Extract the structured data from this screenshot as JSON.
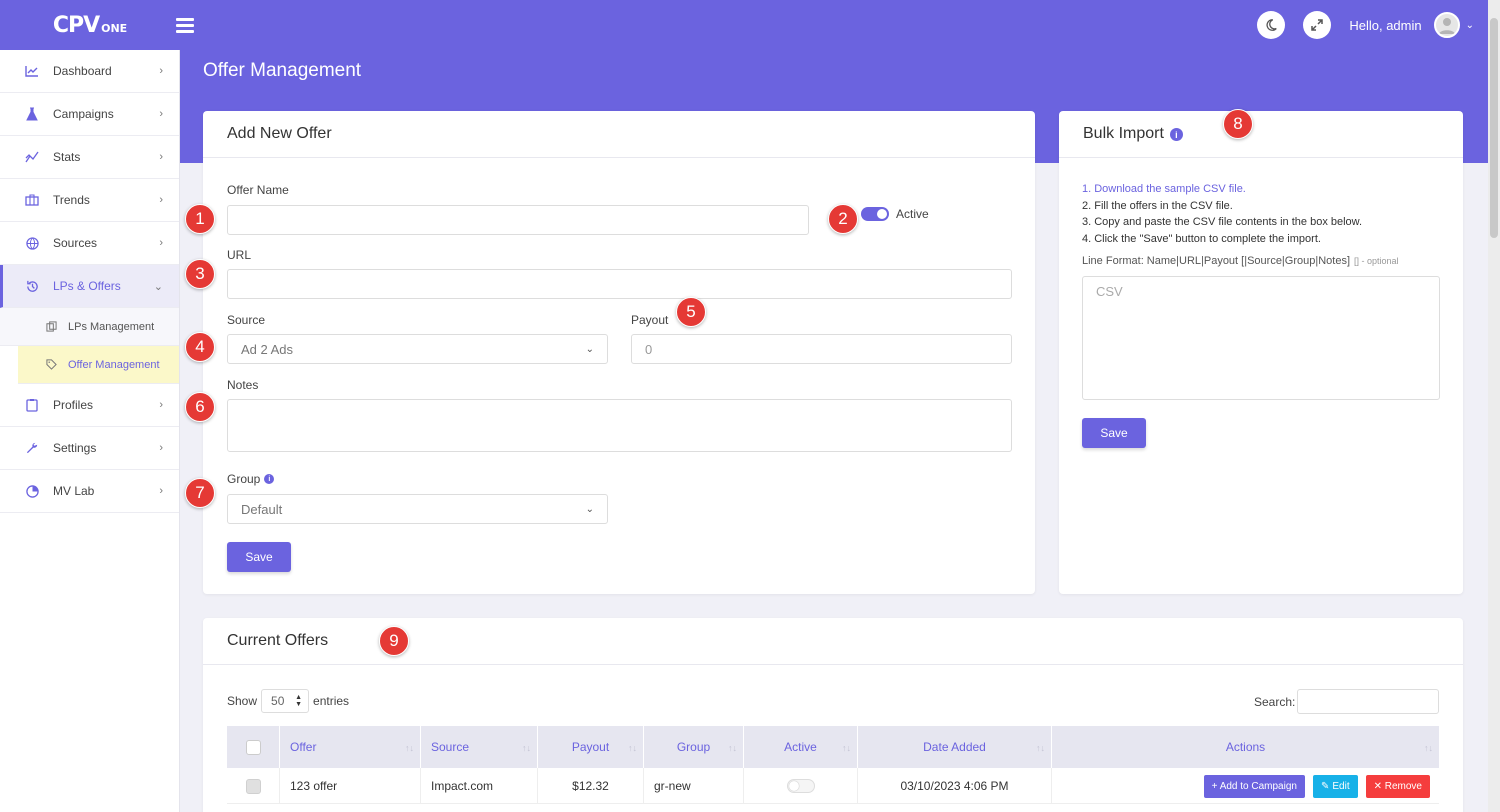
{
  "brand": {
    "logo_main": "CPV",
    "logo_sub": "ONE"
  },
  "topbar": {
    "greeting": "Hello, admin"
  },
  "sidebar": {
    "items": [
      {
        "label": "Dashboard"
      },
      {
        "label": "Campaigns"
      },
      {
        "label": "Stats"
      },
      {
        "label": "Trends"
      },
      {
        "label": "Sources"
      },
      {
        "label": "LPs & Offers"
      },
      {
        "label": "Profiles"
      },
      {
        "label": "Settings"
      },
      {
        "label": "MV Lab"
      }
    ],
    "subitems": [
      {
        "label": "LPs Management"
      },
      {
        "label": "Offer Management"
      }
    ]
  },
  "page": {
    "title": "Offer Management"
  },
  "add_offer": {
    "title": "Add New Offer",
    "offer_name_label": "Offer Name",
    "active_label": "Active",
    "url_label": "URL",
    "source_label": "Source",
    "source_value": "Ad 2 Ads",
    "payout_label": "Payout",
    "payout_placeholder": "0",
    "notes_label": "Notes",
    "group_label": "Group",
    "group_value": "Default",
    "save_label": "Save"
  },
  "bulk_import": {
    "title": "Bulk Import",
    "steps": [
      "1. Download the sample CSV file.",
      "2. Fill the offers in the CSV file.",
      "3. Copy and paste the CSV file contents in the box below.",
      "4. Click the \"Save\" button to complete the import."
    ],
    "format_label": "Line Format: Name|URL|Payout [|Source|Group|Notes]",
    "format_optional": "[] - optional",
    "csv_placeholder": "CSV",
    "save_label": "Save"
  },
  "current_offers": {
    "title": "Current Offers",
    "show_label": "Show",
    "entries_value": "50",
    "entries_label": "entries",
    "search_label": "Search:",
    "columns": [
      "Offer",
      "Source",
      "Payout",
      "Group",
      "Active",
      "Date Added",
      "Actions"
    ],
    "rows": [
      {
        "offer": "123 offer",
        "source": "Impact.com",
        "payout": "$12.32",
        "group": "gr-new",
        "date_added": "03/10/2023 4:06 PM"
      }
    ],
    "actions": {
      "add": "+ Add to Campaign",
      "edit": "Edit",
      "remove": "✕ Remove"
    }
  },
  "markers": [
    "1",
    "2",
    "3",
    "4",
    "5",
    "6",
    "7",
    "8",
    "9"
  ],
  "colors": {
    "accent": "#6b63df",
    "marker": "#e53935",
    "edit": "#17b1e8",
    "remove": "#f53d3d"
  }
}
